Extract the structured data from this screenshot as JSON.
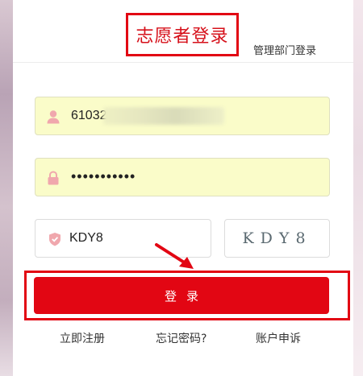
{
  "header": {
    "title": "志愿者登录",
    "admin_login": "管理部门登录"
  },
  "form": {
    "username_value": "61032",
    "username_icon": "user-icon",
    "password_value": "•••••••••••",
    "password_icon": "lock-icon",
    "captcha_value": "KDY8",
    "captcha_icon": "shield-icon",
    "captcha_image_text": "KDY8"
  },
  "login_button": {
    "label": "登录"
  },
  "footer": {
    "register": "立即注册",
    "forgot_password": "忘记密码?",
    "account_appeal": "账户申诉"
  },
  "colors": {
    "accent": "#e20613",
    "field_background": "#fafcc9",
    "icon_pink": "#f0a7ad"
  }
}
